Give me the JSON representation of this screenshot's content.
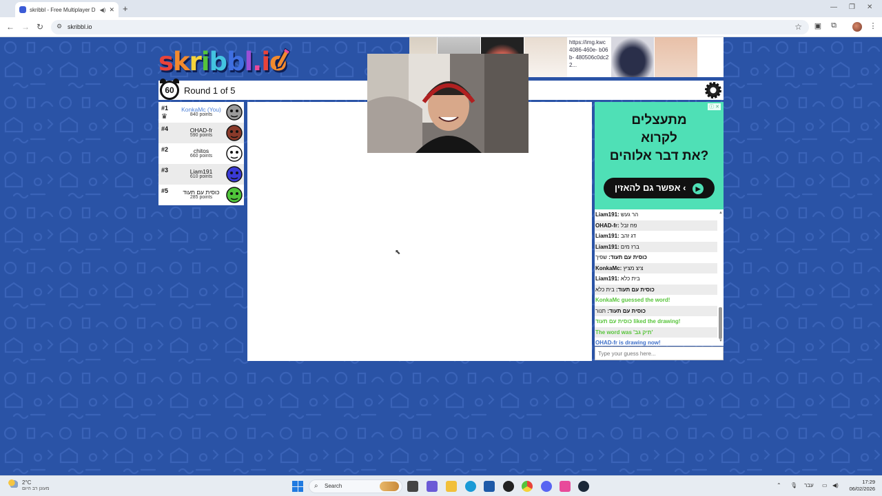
{
  "browser": {
    "tab_title": "skribbl - Free Multiplayer D",
    "url": "skribbl.io"
  },
  "game": {
    "logo_text": "skribbl.io",
    "logo_colors": [
      "#e8433a",
      "#f28a2e",
      "#f5d33a",
      "#55c43c",
      "#43c3e0",
      "#3f6fe0",
      "#9b4fd6",
      "#e84a9a",
      "#e8433a",
      "#f28a2e"
    ],
    "timer": "60",
    "round_text": "Round 1 of 5"
  },
  "ads_top": {
    "broken_image_text": "https://img.kwc 4086-460e- b06b- 480506c0dc22..."
  },
  "players": [
    {
      "rank": "#1",
      "name": "KonkaMc (You)",
      "points": "840 points",
      "you": true,
      "crown": true,
      "avatar_color": "#9a9a9a"
    },
    {
      "rank": "#4",
      "name": "OHAD-fr",
      "points": "590 points",
      "avatar_color": "#8a3a2a"
    },
    {
      "rank": "#2",
      "name": "chitos",
      "points": "660 points",
      "avatar_color": "#ffffff"
    },
    {
      "rank": "#3",
      "name": "Liam191",
      "points": "610 points",
      "avatar_color": "#3a3ad6"
    },
    {
      "rank": "#5",
      "name": "כוסית עם תעוד",
      "points": "285 points",
      "avatar_color": "#4fc43a"
    }
  ],
  "side_ad": {
    "line1": "מתעצלים",
    "line2": "לקרוא",
    "line3": "את דבר אלוהים?",
    "button": "אפשר גם להאזין"
  },
  "chat": {
    "messages": [
      {
        "name": "Liam191:",
        "text": "הר געש",
        "type": "normal"
      },
      {
        "name": "OHAD-fr:",
        "text": "פח זבל",
        "type": "normal"
      },
      {
        "name": "Liam191:",
        "text": "דג זהב",
        "type": "normal"
      },
      {
        "name": "Liam191:",
        "text": "ברז מים",
        "type": "normal"
      },
      {
        "name": "כוסית עם תעוד:",
        "text": "שפיך",
        "type": "normal"
      },
      {
        "name": "KonkaMc:",
        "text": "ציצ מציץ",
        "type": "normal"
      },
      {
        "name": "Liam191:",
        "text": "בית כלא",
        "type": "normal"
      },
      {
        "name": "כוסית עם תעוד:",
        "text": "בית כלא",
        "type": "normal"
      },
      {
        "name": "",
        "text": "KonkaMc guessed the word!",
        "type": "green"
      },
      {
        "name": "כוסית עם תעוד:",
        "text": "תנור",
        "type": "normal"
      },
      {
        "name": "",
        "text": "כוסית עם תעוד liked the drawing!",
        "type": "green"
      },
      {
        "name": "",
        "text": "The word was 'תיק גב'",
        "type": "green"
      },
      {
        "name": "",
        "text": "OHAD-fr is drawing now!",
        "type": "blue"
      }
    ],
    "input_placeholder": "Type your guess here..."
  },
  "taskbar": {
    "temp": "2°C",
    "weather_desc": "מעונן רב היום",
    "search_label": "Search",
    "lang": "עבר",
    "time": "17:29",
    "date": "06/02/2026"
  }
}
